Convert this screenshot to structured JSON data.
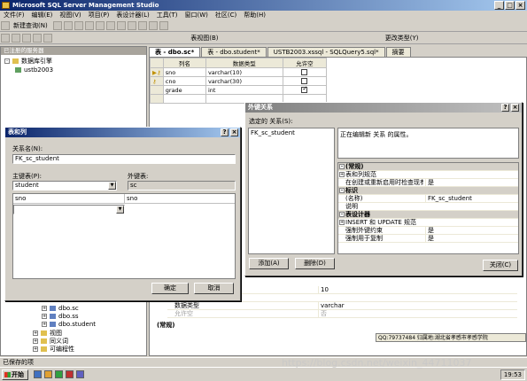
{
  "window": {
    "title": "Microsoft SQL Server Management Studio"
  },
  "menu": [
    "文件(F)",
    "编辑(E)",
    "视图(V)",
    "项目(P)",
    "表设计器(L)",
    "工具(T)",
    "窗口(W)",
    "社区(C)",
    "帮助(H)"
  ],
  "toolbar": {
    "new_query": "新建查询(N)",
    "table_view": "表视图(B)",
    "change_type": "更改类型(Y)"
  },
  "object_explorer": {
    "title": "已注册的服务器",
    "root": "数据库引擎",
    "server": "ustb2003",
    "tables": [
      "dbo.sc",
      "dbo.ss",
      "dbo.student"
    ],
    "folders": [
      "视图",
      "同义词",
      "可编程性"
    ]
  },
  "tabs": [
    "表 - dbo.sc*",
    "表 - dbo.student*",
    "USTB2003.xssql - SQLQuery5.sql*",
    "摘要"
  ],
  "table_designer": {
    "headers": [
      "列名",
      "数据类型",
      "允许空"
    ],
    "rows": [
      {
        "name": "sno",
        "type": "varchar(10)",
        "nullable": false,
        "key": true
      },
      {
        "name": "cno",
        "type": "varchar(30)",
        "nullable": false,
        "key": true
      },
      {
        "name": "grade",
        "type": "int",
        "nullable": true,
        "key": false
      }
    ]
  },
  "column_props": {
    "length_value": "10",
    "type_label": "数据类型",
    "type_value": "varchar",
    "allow_null": "允许空",
    "allow_null_value": "否",
    "section": "(常规)"
  },
  "fk_dialog": {
    "title": "外键关系",
    "selected_label": "选定的 关系(S):",
    "selected_item": "FK_sc_student",
    "desc": "正在编辑新 关系 的属性。",
    "props": [
      {
        "cat": true,
        "name": "(常规)"
      },
      {
        "name": "表和列规范",
        "value": "",
        "plus": true
      },
      {
        "name": "在创建或重新启用时检查现有数据",
        "value": "是"
      },
      {
        "cat": true,
        "name": "标识"
      },
      {
        "name": "(名称)",
        "value": "FK_sc_student"
      },
      {
        "name": "说明",
        "value": ""
      },
      {
        "cat": true,
        "name": "表设计器"
      },
      {
        "name": "INSERT 和 UPDATE 规范",
        "value": "",
        "plus": true
      },
      {
        "name": "强制外键约束",
        "value": "是"
      },
      {
        "name": "强制用于复制",
        "value": "是"
      }
    ],
    "add": "添加(A)",
    "delete": "删除(D)",
    "close": "关闭(C)"
  },
  "tc_dialog": {
    "title": "表和列",
    "name_label": "关系名(N):",
    "name_value": "FK_sc_student",
    "pk_label": "主键表(P):",
    "pk_value": "student",
    "fk_label": "外键表:",
    "fk_value": "sc",
    "pk_col": "sno",
    "fk_col": "sno",
    "ok": "确定",
    "cancel": "取消"
  },
  "status": "已保存的项",
  "qq_note": "QQ:79737484 归属地:湖北省孝感市孝感学院",
  "clock": "19:53",
  "watermark": "https://blog.csdn.net/weixin_44711037"
}
